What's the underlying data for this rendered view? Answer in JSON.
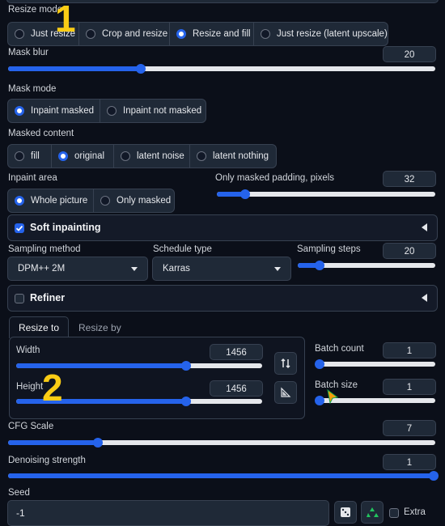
{
  "resize_mode": {
    "label": "Resize mode",
    "options": [
      "Just resize",
      "Crop and resize",
      "Resize and fill",
      "Just resize (latent upscale)"
    ],
    "selected": "Resize and fill"
  },
  "mask_blur": {
    "label": "Mask blur",
    "value": "20",
    "fraction": 0.31
  },
  "mask_mode": {
    "label": "Mask mode",
    "options": [
      "Inpaint masked",
      "Inpaint not masked"
    ],
    "selected": "Inpaint masked"
  },
  "masked_content": {
    "label": "Masked content",
    "options": [
      "fill",
      "original",
      "latent noise",
      "latent nothing"
    ],
    "selected": "original"
  },
  "inpaint_area": {
    "label": "Inpaint area",
    "options": [
      "Whole picture",
      "Only masked"
    ],
    "selected": "Whole picture"
  },
  "padding": {
    "label": "Only masked padding, pixels",
    "value": "32",
    "fraction": 0.13
  },
  "soft_inpainting": {
    "label": "Soft inpainting",
    "checked": true
  },
  "sampling_method": {
    "label": "Sampling method",
    "value": "DPM++ 2M"
  },
  "schedule_type": {
    "label": "Schedule type",
    "value": "Karras"
  },
  "sampling_steps": {
    "label": "Sampling steps",
    "value": "20",
    "fraction": 0.16
  },
  "refiner": {
    "label": "Refiner",
    "checked": false
  },
  "tabs": [
    "Resize to",
    "Resize by"
  ],
  "width": {
    "label": "Width",
    "value": "1456",
    "fraction": 0.69
  },
  "height": {
    "label": "Height",
    "value": "1456",
    "fraction": 0.69
  },
  "batch_count": {
    "label": "Batch count",
    "value": "1",
    "fraction": 0.0
  },
  "batch_size": {
    "label": "Batch size",
    "value": "1",
    "fraction": 0.0
  },
  "cfg_scale": {
    "label": "CFG Scale",
    "value": "7",
    "fraction": 0.21
  },
  "denoising": {
    "label": "Denoising strength",
    "value": "1",
    "fraction": 1.0
  },
  "seed": {
    "label": "Seed",
    "value": "-1"
  },
  "extra": {
    "label": "Extra",
    "checked": false
  },
  "annotations": [
    "1",
    "2"
  ],
  "colors": {
    "accent": "#2563eb",
    "background": "#0b0f19",
    "panel": "#1f2937",
    "annotation": "#facc15"
  },
  "icons": [
    "swap-dimensions-icon",
    "aspect-ratio-icon",
    "dice-icon",
    "recycle-icon",
    "collapse-triangle-icon"
  ]
}
